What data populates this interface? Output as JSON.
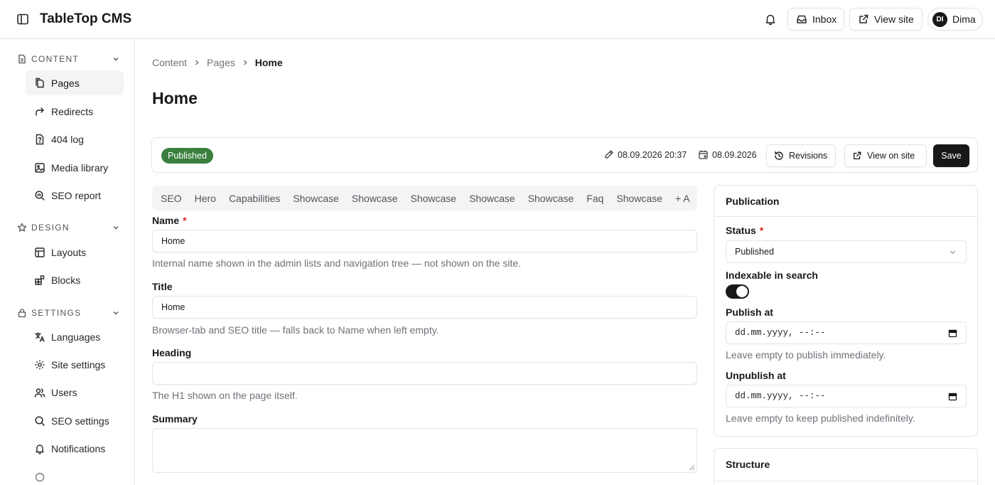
{
  "app": {
    "title": "TableTop CMS"
  },
  "header": {
    "inbox_label": "Inbox",
    "view_site_label": "View site",
    "user_initials": "DI",
    "user_name": "Dima"
  },
  "sidebar": {
    "sections": [
      {
        "title": "CONTENT",
        "items": [
          "Pages",
          "Redirects",
          "404 log",
          "Media library",
          "SEO report"
        ]
      },
      {
        "title": "DESIGN",
        "items": [
          "Layouts",
          "Blocks"
        ]
      },
      {
        "title": "SETTINGS",
        "items": [
          "Languages",
          "Site settings",
          "Users",
          "SEO settings",
          "Notifications"
        ]
      }
    ],
    "active_item": "Pages"
  },
  "breadcrumb": [
    "Content",
    "Pages",
    "Home"
  ],
  "page": {
    "title": "Home"
  },
  "toolbar": {
    "status_badge": "Published",
    "edited_at": "08.09.2026 20:37",
    "date": "08.09.2026",
    "revisions_label": "Revisions",
    "view_on_site_label": "View on site",
    "save_label": "Save"
  },
  "tabs": [
    "SEO",
    "Hero",
    "Capabilities",
    "Showcase",
    "Showcase",
    "Showcase",
    "Showcase",
    "Showcase",
    "Faq",
    "Showcase",
    "+ A"
  ],
  "form": {
    "name": {
      "label": "Name",
      "required": "*",
      "value": "Home",
      "help": "Internal name shown in the admin lists and navigation tree — not shown on the site."
    },
    "title": {
      "label": "Title",
      "value": "Home",
      "help": "Browser-tab and SEO title — falls back to Name when left empty."
    },
    "heading": {
      "label": "Heading",
      "value": "",
      "help": "The H1 shown on the page itself."
    },
    "summary": {
      "label": "Summary",
      "value": ""
    }
  },
  "publication": {
    "title": "Publication",
    "status_label": "Status",
    "status_required": "*",
    "status_value": "Published",
    "indexable_label": "Indexable in search",
    "indexable": true,
    "publish_at_label": "Publish at",
    "publish_at_value": "dd.mm.yyyy, --:--",
    "publish_at_help": "Leave empty to publish immediately.",
    "unpublish_at_label": "Unpublish at",
    "unpublish_at_value": "dd.mm.yyyy, --:--",
    "unpublish_at_help": "Leave empty to keep published indefinitely."
  },
  "structure": {
    "title": "Structure"
  },
  "icons": {
    "sidebar_toggle": "sidebar-toggle-icon",
    "bell": "bell-icon",
    "inbox": "inbox-icon",
    "external": "external-link-icon",
    "pencil": "pencil-icon",
    "calendar": "calendar-icon",
    "history": "history-icon"
  },
  "colors": {
    "published_badge": "#3a7f3d",
    "primary": "#18181b",
    "required": "#dc2626"
  }
}
